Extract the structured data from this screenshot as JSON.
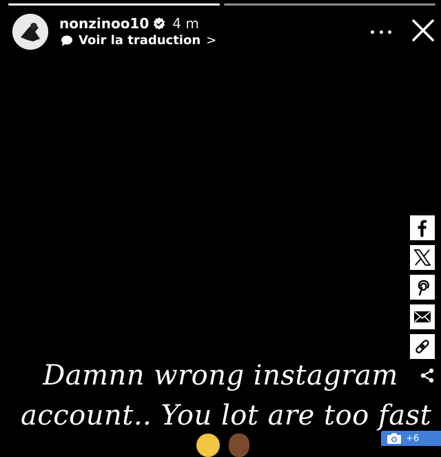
{
  "story": {
    "progress": [
      {
        "fill_percent": 100
      },
      {
        "fill_percent": 0
      }
    ],
    "username": "nonzinoo10",
    "time": "4 m",
    "translate_label": "Voir la traduction",
    "translate_chevron": ">",
    "caption_lines": [
      "Damnn wrong instagram",
      "account.. You lot are too fast"
    ]
  },
  "share": {
    "buttons": [
      {
        "icon": "facebook-icon"
      },
      {
        "icon": "x-icon"
      },
      {
        "icon": "pinterest-icon"
      },
      {
        "icon": "email-icon"
      },
      {
        "icon": "link-icon"
      }
    ],
    "more_icon": "share-icon"
  },
  "photo_badge": {
    "count": "+6"
  },
  "colors": {
    "background": "#000000",
    "badge": "#3f7fd8"
  }
}
